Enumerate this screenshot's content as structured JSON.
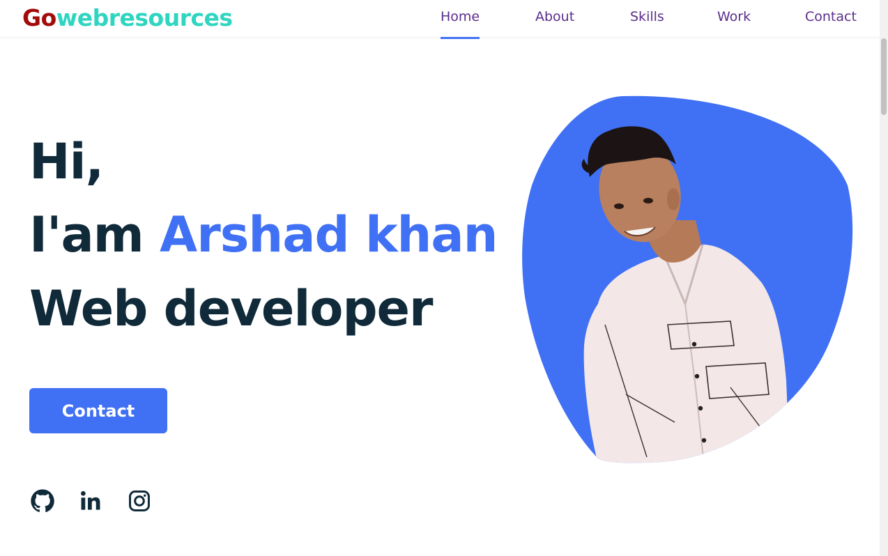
{
  "header": {
    "logo": {
      "part1": "Go",
      "part2": "webresources"
    },
    "nav": [
      {
        "label": "Home",
        "active": true
      },
      {
        "label": "About",
        "active": false
      },
      {
        "label": "Skills",
        "active": false
      },
      {
        "label": "Work",
        "active": false
      },
      {
        "label": "Contact",
        "active": false
      }
    ]
  },
  "hero": {
    "line1": "Hi,",
    "line2_prefix": "I'am ",
    "line2_name": "Arshad khan",
    "line3": "Web developer",
    "button_label": "Contact"
  },
  "social": [
    {
      "icon": "github-icon"
    },
    {
      "icon": "linkedin-icon"
    },
    {
      "icon": "instagram-icon"
    }
  ],
  "colors": {
    "accent": "#4070f4",
    "logo_red": "#a30b0b",
    "logo_teal": "#2ed5c0",
    "nav_text": "#5a2d8c",
    "heading": "#102a3a"
  }
}
